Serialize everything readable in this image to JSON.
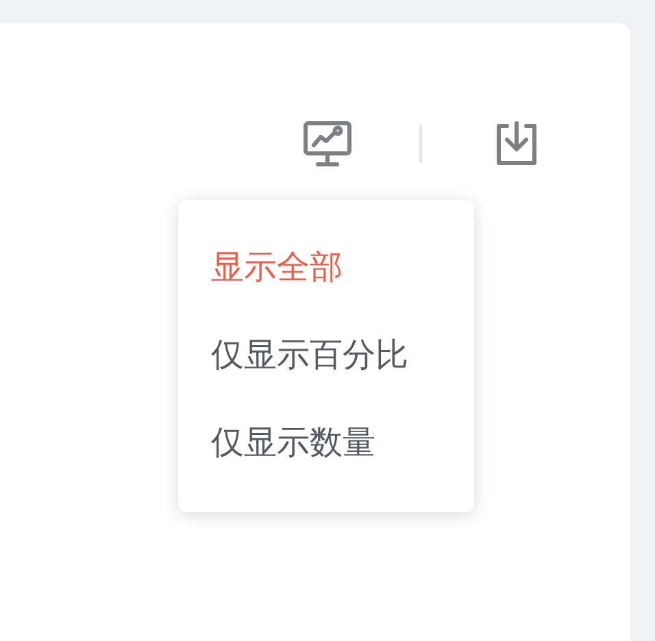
{
  "menu": {
    "items": [
      {
        "label": "显示全部",
        "selected": true
      },
      {
        "label": "仅显示百分比",
        "selected": false
      },
      {
        "label": "仅显示数量",
        "selected": false
      }
    ]
  }
}
